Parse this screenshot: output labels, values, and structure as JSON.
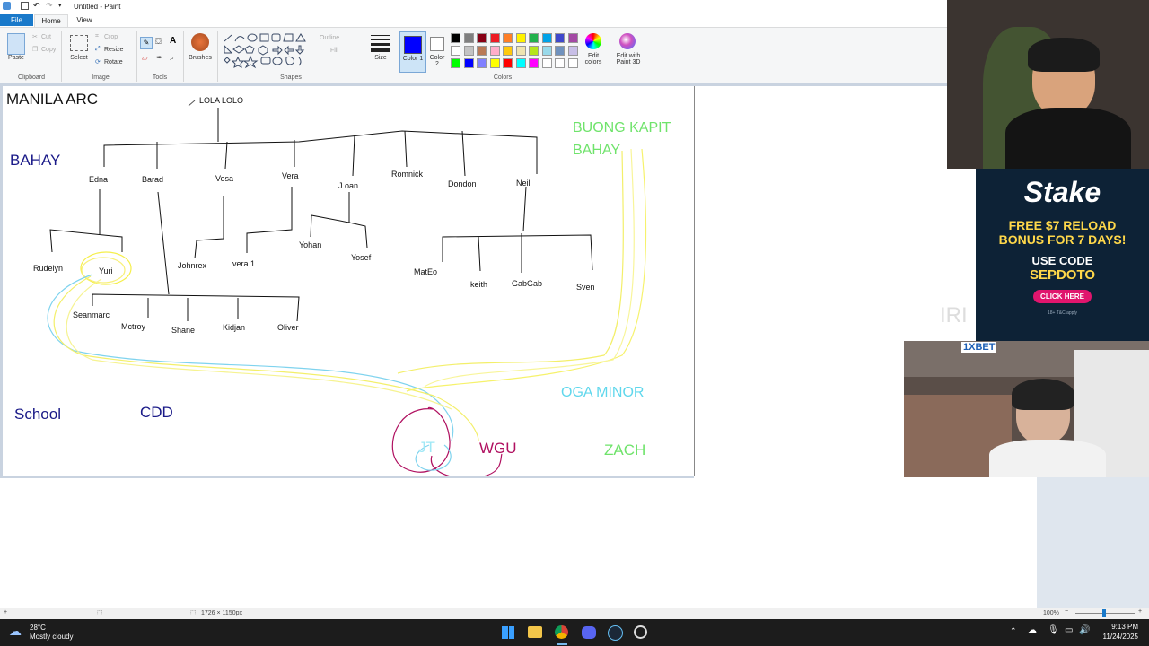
{
  "window": {
    "title": "Untitled - Paint"
  },
  "menu": {
    "file": "File",
    "home": "Home",
    "view": "View"
  },
  "ribbon": {
    "clipboard": {
      "paste": "Paste",
      "cut": "Cut",
      "copy": "Copy",
      "group": "Clipboard"
    },
    "image": {
      "select": "Select",
      "crop": "Crop",
      "resize": "Resize",
      "rotate": "Rotate",
      "group": "Image"
    },
    "tools": {
      "group": "Tools"
    },
    "brushes": {
      "label": "Brushes"
    },
    "shapes": {
      "outline": "Outline",
      "fill": "Fill",
      "group": "Shapes"
    },
    "size": {
      "label": "Size"
    },
    "colors": {
      "color1_label": "Color 1",
      "color2_label": "Color 2",
      "edit_colors": "Edit colors",
      "edit_paint3d": "Edit with Paint 3D",
      "group": "Colors",
      "color1": "#0000ff",
      "color2": "#ffffff",
      "row1": [
        "#000000",
        "#7f7f7f",
        "#880015",
        "#ed1c24",
        "#ff7f27",
        "#fff200",
        "#22b14c",
        "#00a2e8",
        "#3f48cc",
        "#a349a4"
      ],
      "row2": [
        "#ffffff",
        "#c3c3c3",
        "#b97a57",
        "#ffaec9",
        "#ffc90e",
        "#efe4b0",
        "#b5e61d",
        "#99d9ea",
        "#7092be",
        "#c8bfe7"
      ],
      "row3": [
        "#00ff00",
        "#0000ff",
        "#8080ff",
        "#ffff00",
        "#ff0000",
        "#00ffff",
        "#ff00ff",
        "#ffffff",
        "#ffffff",
        "#ffffff"
      ]
    }
  },
  "drawing": {
    "title": "MANILA ARC",
    "root": "LOLA LOLO",
    "bahay": "BAHAY",
    "buong1": "BUONG KAPIT",
    "buong2": "BAHAY",
    "school": "School",
    "cdd": "CDD",
    "oga": "OGA MINOR",
    "zach": "ZACH",
    "jt": "JT",
    "wgu": "WGU",
    "children": [
      "Edna",
      "Barad",
      "Vesa",
      "Vera",
      "J oan",
      "Romnick",
      "Dondon",
      "Neil"
    ],
    "grand": {
      "rudelyn": "Rudelyn",
      "yuri": "Yuri",
      "johnrex": "Johnrex",
      "vera1": "vera 1",
      "yohan": "Yohan",
      "yosef": "Yosef",
      "mateo": "MatEo",
      "keith": "keith",
      "gabgab": "GabGab",
      "sven": "Sven",
      "seanmarc": "Seanmarc",
      "mctroy": "Mctroy",
      "shane": "Shane",
      "kidjan": "Kidjan",
      "oliver": "Oliver"
    }
  },
  "status": {
    "dimensions": "1726 × 1150px",
    "zoom": "100%"
  },
  "taskbar": {
    "temp": "28°C",
    "weather": "Mostly cloudy",
    "time": "9:13 PM",
    "date": "11/24/2025"
  },
  "ad": {
    "brand": "Stake",
    "line1": "FREE $7 RELOAD",
    "line2": "BONUS FOR 7 DAYS!",
    "line3": "USE CODE",
    "code": "SEPDOTO",
    "cta": "CLICK HERE",
    "small": "18+ T&C apply"
  },
  "overlay": {
    "bet": "1XBET",
    "ghost": "IRI"
  }
}
